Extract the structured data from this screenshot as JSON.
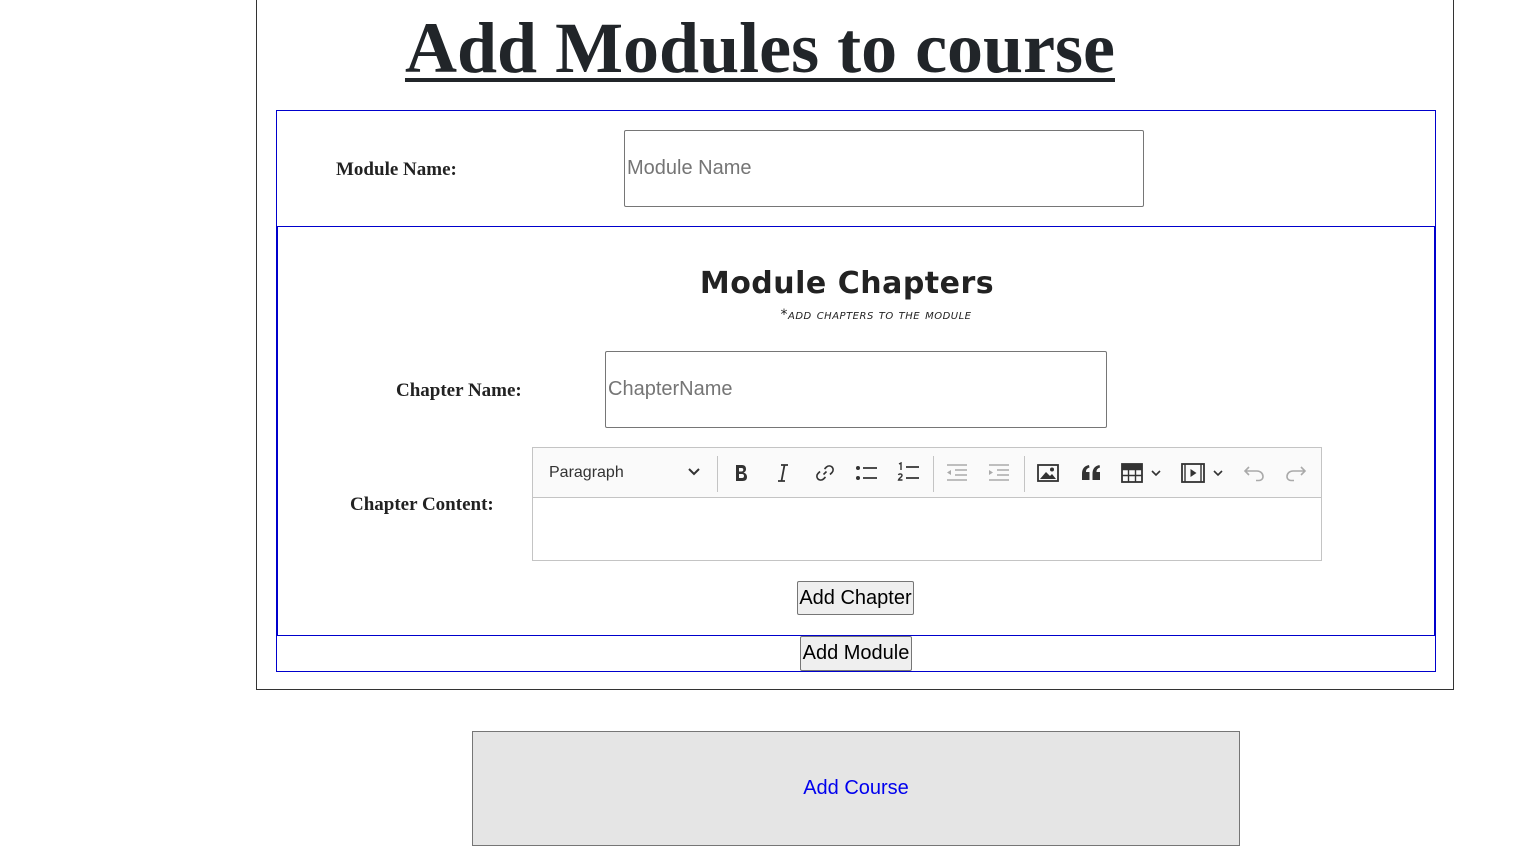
{
  "page": {
    "title": "Add Modules to course"
  },
  "module_form": {
    "module_name_label": "Module Name:",
    "module_name_placeholder": "Module Name",
    "module_name_value": ""
  },
  "chapters": {
    "heading": "Module Chapters",
    "subheading": "*add chapters to the module",
    "chapter_name_label": "Chapter Name:",
    "chapter_name_placeholder": "ChapterName",
    "chapter_name_value": "",
    "chapter_content_label": "Chapter Content:",
    "editor": {
      "block_format": "Paragraph",
      "toolbar_icons": [
        "bold-icon",
        "italic-icon",
        "link-icon",
        "bulleted-list-icon",
        "numbered-list-icon",
        "outdent-icon",
        "indent-icon",
        "image-icon",
        "blockquote-icon",
        "table-icon",
        "media-icon",
        "undo-icon",
        "redo-icon"
      ],
      "content": ""
    },
    "add_chapter_label": "Add Chapter"
  },
  "add_module_label": "Add Module",
  "add_course_label": "Add Course",
  "colors": {
    "section_border": "#0000cc",
    "link_blue": "#0000ee",
    "title_color": "#212529"
  }
}
